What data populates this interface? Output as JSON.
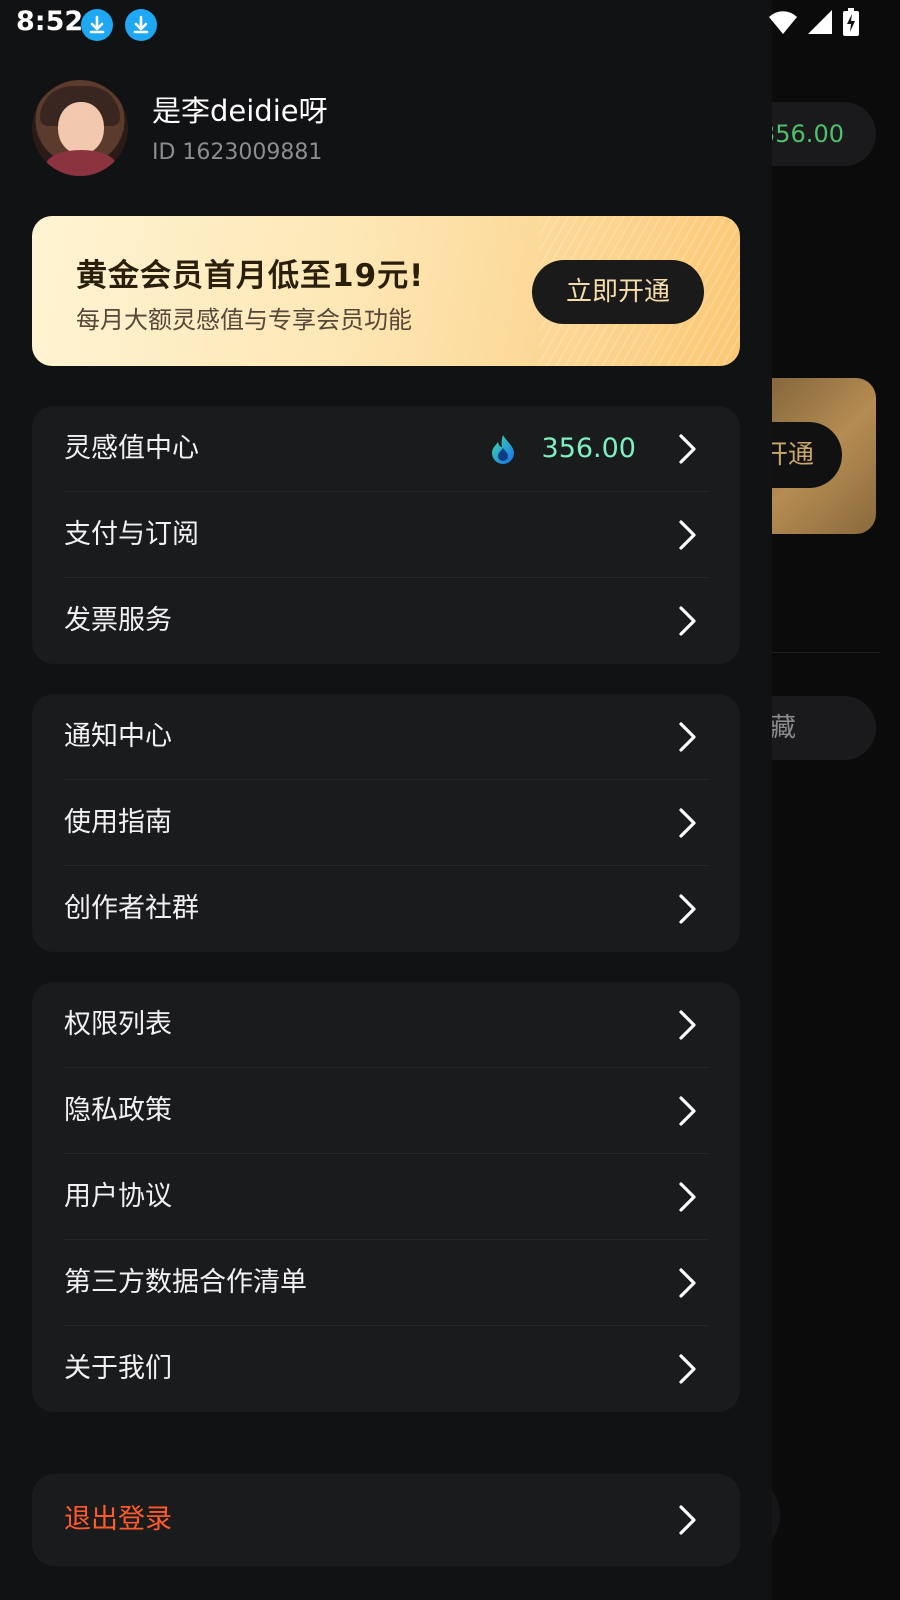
{
  "status_bar": {
    "time": "8:52"
  },
  "background": {
    "balance": "356.00",
    "vip_button": "开通",
    "collect": "藏"
  },
  "profile": {
    "name": "是李deidie呀",
    "id": "ID 1623009881"
  },
  "promo": {
    "title": "黄金会员首月低至19元!",
    "subtitle": "每月大额灵感值与专享会员功能",
    "button": "立即开通"
  },
  "groups": [
    {
      "items": [
        {
          "label": "灵感值中心",
          "value": "356.00"
        },
        {
          "label": "支付与订阅"
        },
        {
          "label": "发票服务"
        }
      ]
    },
    {
      "items": [
        {
          "label": "通知中心"
        },
        {
          "label": "使用指南"
        },
        {
          "label": "创作者社群"
        }
      ]
    },
    {
      "items": [
        {
          "label": "权限列表"
        },
        {
          "label": "隐私政策"
        },
        {
          "label": "用户协议"
        },
        {
          "label": "第三方数据合作清单"
        },
        {
          "label": "关于我们"
        }
      ]
    }
  ],
  "logout": {
    "label": "退出登录"
  },
  "colors": {
    "accent_value": "#7ff0c0",
    "logout": "#ff5a2c",
    "promo_gold": "#fcd48e",
    "download_badge": "#1ea7f2"
  }
}
